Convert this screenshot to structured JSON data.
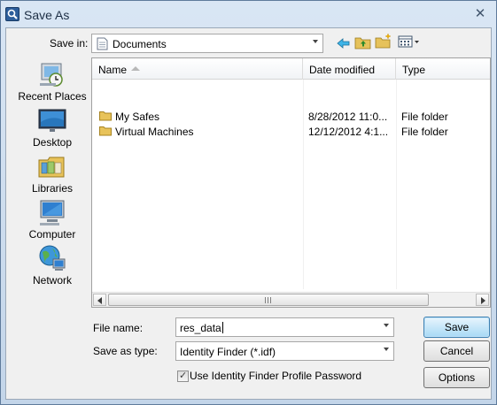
{
  "window": {
    "title": "Save As"
  },
  "save_in": {
    "label": "Save in:",
    "value": "Documents"
  },
  "toolbar_icons": [
    "back-arrow-icon",
    "up-one-level-icon",
    "new-folder-icon",
    "views-menu-icon"
  ],
  "places": [
    {
      "label": "Recent Places",
      "icon": "recent-places-icon"
    },
    {
      "label": "Desktop",
      "icon": "desktop-icon"
    },
    {
      "label": "Libraries",
      "icon": "libraries-icon"
    },
    {
      "label": "Computer",
      "icon": "computer-icon"
    },
    {
      "label": "Network",
      "icon": "network-icon"
    }
  ],
  "file_list": {
    "columns": [
      "Name",
      "Date modified",
      "Type"
    ],
    "rows": [
      {
        "name": "My Safes",
        "date": "8/28/2012 11:0...",
        "type": "File folder"
      },
      {
        "name": "Virtual Machines",
        "date": "12/12/2012 4:1...",
        "type": "File folder"
      }
    ]
  },
  "file_name": {
    "label": "File name:",
    "value": "res_data"
  },
  "save_as_type": {
    "label": "Save as type:",
    "value": "Identity Finder (*.idf)"
  },
  "checkbox": {
    "label": "Use Identity Finder Profile Password",
    "checked": true
  },
  "buttons": {
    "save": "Save",
    "cancel": "Cancel",
    "options": "Options"
  },
  "colors": {
    "default_button": "#a7d9f5",
    "folder": "#e8c35a",
    "titlebar": "#d9e6f4"
  }
}
